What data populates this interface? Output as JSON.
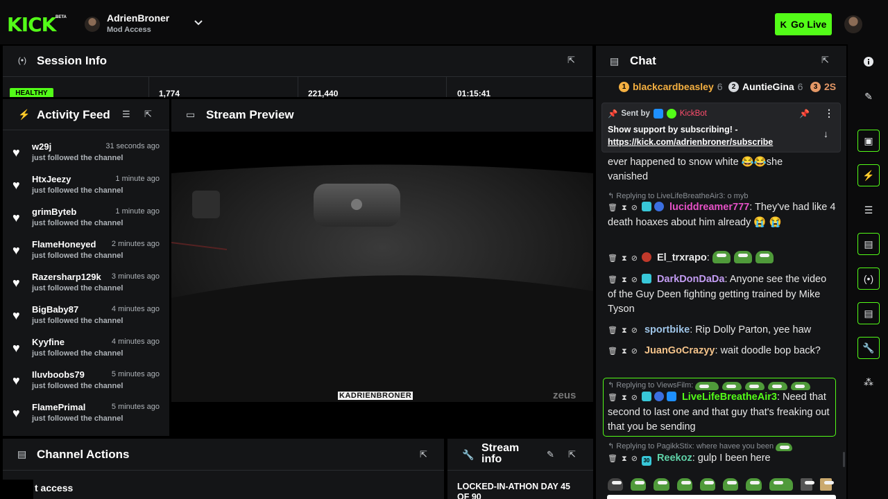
{
  "topbar": {
    "logo": "KICK",
    "beta": "BETA",
    "channel_name": "AdrienBroner",
    "channel_role": "Mod Access",
    "go_live_label": "Go Live"
  },
  "session_info": {
    "title": "Session Info",
    "health_badge": "HEALTHY",
    "stat_1": "1,774",
    "stat_2": "221,440",
    "uptime": "01:15:41"
  },
  "activity_feed": {
    "title": "Activity Feed",
    "items": [
      {
        "name": "w29j",
        "time": "31 seconds ago",
        "action": "just followed the channel"
      },
      {
        "name": "HtxJeezy",
        "time": "1 minute ago",
        "action": "just followed the channel"
      },
      {
        "name": "grimByteb",
        "time": "1 minute ago",
        "action": "just followed the channel"
      },
      {
        "name": "FlameHoneyed",
        "time": "2 minutes ago",
        "action": "just followed the channel"
      },
      {
        "name": "Razersharp129k",
        "time": "3 minutes ago",
        "action": "just followed the channel"
      },
      {
        "name": "BigBaby87",
        "time": "4 minutes ago",
        "action": "just followed the channel"
      },
      {
        "name": "Kyyfine",
        "time": "4 minutes ago",
        "action": "just followed the channel"
      },
      {
        "name": "Iluvboobs79",
        "time": "5 minutes ago",
        "action": "just followed the channel"
      },
      {
        "name": "FlamePrimal",
        "time": "5 minutes ago",
        "action": "just followed the channel"
      }
    ]
  },
  "stream_preview": {
    "title": "Stream Preview",
    "overlay_handle": "KADRIENBRONER",
    "watermark": "zeus"
  },
  "channel_actions": {
    "title": "Channel Actions",
    "partial_item": "t access"
  },
  "stream_info": {
    "title_line1": "Stream",
    "title_line2": "info",
    "stream_title": "LOCKED-IN-ATHON DAY 45",
    "stream_title_2": "OF 90"
  },
  "chat": {
    "title": "Chat",
    "gifters": [
      {
        "rank": "1",
        "name": "blackcardbeasley",
        "count": "6",
        "color": "#f5b041"
      },
      {
        "rank": "2",
        "name": "AuntieGina",
        "count": "6",
        "color": "#d5d8dc"
      },
      {
        "rank": "3",
        "name": "2S",
        "count": "",
        "color": "#e59866"
      }
    ],
    "pinned": {
      "sent_by": "Sent by",
      "sender": "KickBot",
      "text": "Show support by subscribing! -",
      "link": "https://kick.com/adrienbroner/subscribe"
    },
    "messages": {
      "m0_text": "ever happened to snow white 😂😂she vanished",
      "m1_reply": "Replying to LiveLifeBreatheAir3: o myb",
      "m1_user": "luciddreamer777",
      "m1_text": "They've had like 4 death hoaxes about him already 😭 😭",
      "m2_user": "El_trxrapo",
      "m3_user": "DarkDonDaDa",
      "m3_text": "Anyone see the video of the Guy Deen fighting getting trained by Mike Tyson",
      "m4_user": "sportbike",
      "m4_text": "Rip Dolly Parton, yee haw",
      "m5_user": "JuanGoCrazyy",
      "m5_text": "wait doodle bop back?",
      "m6_reply": "Replying to ViewsFilm:",
      "m6_user": "LiveLifeBreatheAir3",
      "m6_text": "Need that second to last one and that guy that's freaking out that you be sending",
      "m7_reply": "Replying to PagikkStix: where havee you been",
      "m7_user": "Reekoz",
      "m7_text": "gulp I been here",
      "badge_sub_label": "30"
    }
  },
  "colors": {
    "accent": "#53fc18",
    "panel": "#141517",
    "kickbot": "#ff4d6d",
    "lucid": "#e651c6",
    "darkdon": "#c29cf2",
    "sportbike": "#9fc5e8",
    "juan": "#f4c38a",
    "livelife": "#53fc18",
    "reekoz": "#5fd3a8"
  }
}
